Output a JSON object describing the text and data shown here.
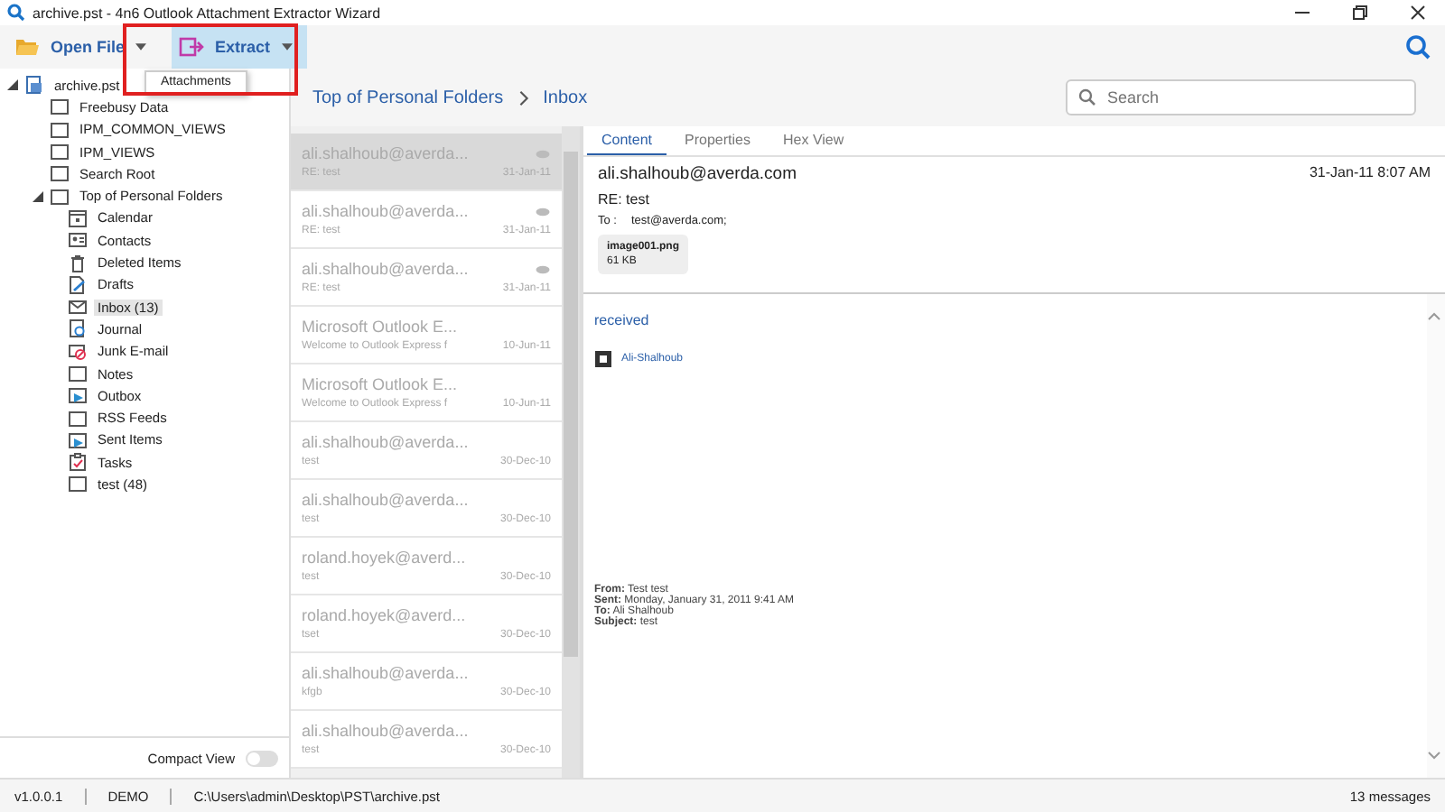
{
  "window": {
    "title": "archive.pst - 4n6 Outlook Attachment Extractor Wizard"
  },
  "toolbar": {
    "buttons": [
      {
        "kind": "open",
        "label": "Open File",
        "selected": false
      },
      {
        "kind": "extract",
        "label": "Extract",
        "selected": true
      }
    ],
    "menu": {
      "items": [
        "Attachments"
      ]
    }
  },
  "tree": [
    {
      "label": "archive.pst",
      "kind": "pst",
      "selected": false,
      "expanded": true,
      "children": [
        {
          "label": "Freebusy Data",
          "kind": "folder",
          "selected": false
        },
        {
          "label": "IPM_COMMON_VIEWS",
          "kind": "folder",
          "selected": false
        },
        {
          "label": "IPM_VIEWS",
          "kind": "folder",
          "selected": false
        },
        {
          "label": "Search Root",
          "kind": "folder",
          "selected": false
        },
        {
          "label": "Top of Personal Folders",
          "kind": "folder",
          "selected": false,
          "expanded": true,
          "children": [
            {
              "label": "Calendar",
              "kind": "calendar",
              "selected": false
            },
            {
              "label": "Contacts",
              "kind": "contacts",
              "selected": false
            },
            {
              "label": "Deleted Items",
              "kind": "trash",
              "selected": false
            },
            {
              "label": "Drafts",
              "kind": "drafts",
              "selected": false
            },
            {
              "label": "Inbox (13)",
              "kind": "inbox",
              "selected": true
            },
            {
              "label": "Journal",
              "kind": "journal",
              "selected": false
            },
            {
              "label": "Junk E-mail",
              "kind": "junk",
              "selected": false
            },
            {
              "label": "Notes",
              "kind": "folder",
              "selected": false
            },
            {
              "label": "Outbox",
              "kind": "outbox",
              "selected": false
            },
            {
              "label": "RSS Feeds",
              "kind": "folder",
              "selected": false
            },
            {
              "label": "Sent Items",
              "kind": "outbox",
              "selected": false
            },
            {
              "label": "Tasks",
              "kind": "tasks",
              "selected": false
            },
            {
              "label": "test (48)",
              "kind": "folder",
              "selected": false
            }
          ]
        }
      ]
    }
  ],
  "compact_view": {
    "label": "Compact View",
    "on": false
  },
  "breadcrumb": [
    "Top of Personal Folders",
    "Inbox"
  ],
  "search": {
    "placeholder": "Search"
  },
  "messages": [
    {
      "sender": "ali.shalhoub@averda...",
      "subject": "RE: test",
      "date": "31-Jan-11",
      "attachment": true,
      "selected": true
    },
    {
      "sender": "ali.shalhoub@averda...",
      "subject": "RE: test",
      "date": "31-Jan-11",
      "attachment": true,
      "selected": false
    },
    {
      "sender": "ali.shalhoub@averda...",
      "subject": "RE: test",
      "date": "31-Jan-11",
      "attachment": true,
      "selected": false
    },
    {
      "sender": "Microsoft Outlook E...",
      "subject": "Welcome to Outlook Express f",
      "date": "10-Jun-11",
      "attachment": false,
      "selected": false
    },
    {
      "sender": "Microsoft Outlook E...",
      "subject": "Welcome to Outlook Express f",
      "date": "10-Jun-11",
      "attachment": false,
      "selected": false
    },
    {
      "sender": "ali.shalhoub@averda...",
      "subject": "test",
      "date": "30-Dec-10",
      "attachment": false,
      "selected": false
    },
    {
      "sender": "ali.shalhoub@averda...",
      "subject": "test",
      "date": "30-Dec-10",
      "attachment": false,
      "selected": false
    },
    {
      "sender": "roland.hoyek@averd...",
      "subject": "test",
      "date": "30-Dec-10",
      "attachment": false,
      "selected": false
    },
    {
      "sender": "roland.hoyek@averd...",
      "subject": "tset",
      "date": "30-Dec-10",
      "attachment": false,
      "selected": false
    },
    {
      "sender": "ali.shalhoub@averda...",
      "subject": "kfgb",
      "date": "30-Dec-10",
      "attachment": false,
      "selected": false
    },
    {
      "sender": "ali.shalhoub@averda...",
      "subject": "test",
      "date": "30-Dec-10",
      "attachment": false,
      "selected": false
    }
  ],
  "preview": {
    "tabs": [
      {
        "label": "Content",
        "selected": true
      },
      {
        "label": "Properties",
        "selected": false
      },
      {
        "label": "Hex View",
        "selected": false
      }
    ],
    "sender": "ali.shalhoub@averda.com",
    "date": "31-Jan-11 8:07 AM",
    "subject": "RE: test",
    "to_label": "To :",
    "to": "test@averda.com;",
    "attachments": [
      {
        "name": "image001.png",
        "size": "61 KB"
      }
    ],
    "body": {
      "heading": "received",
      "signature": "Ali-Shalhoub",
      "quoted": [
        "**From:** Test test",
        "**Sent:** Monday, January 31, 2011 9:41 AM",
        "**To:** Ali Shalhoub",
        "**Subject:** test"
      ]
    }
  },
  "status_bar": {
    "version": "v1.0.0.1",
    "mode": "DEMO",
    "path": "C:\\Users\\admin\\Desktop\\PST\\archive.pst",
    "count": "13 messages"
  }
}
